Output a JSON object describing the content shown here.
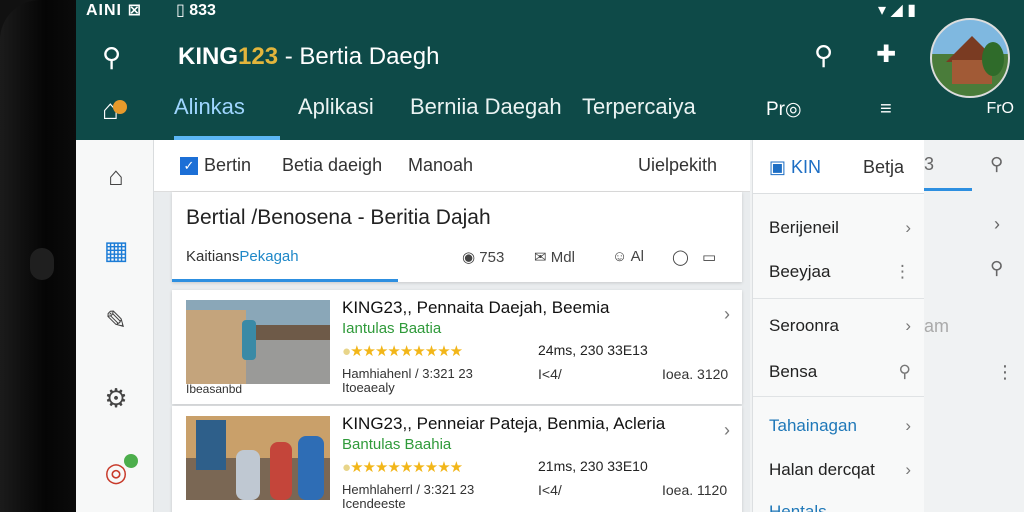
{
  "status": {
    "left": "AINI ⊠",
    "time": "▯ 833",
    "right": "▾ ◢ ▮"
  },
  "appbar": {
    "title_brand": "KING",
    "title_brand_num": "123",
    "title_rest": " - Bertia Daegh",
    "corner_label": "FrO"
  },
  "tabs": [
    "Alinkas",
    "Aplikasi",
    "Berniia Daegah",
    "Terpercaiya"
  ],
  "tab_extras": {
    "pro": "Pr◎",
    "lines": "≡"
  },
  "breadcrumb": {
    "item1": "Bertin",
    "item2": "Betia daeigh",
    "item3": "Manoah",
    "item4": "Uielpekith"
  },
  "heading": {
    "title": "Bertial /Benosena - Beritia Dajah",
    "sub_prefix": "Kaitians",
    "sub_highlight": "Pekagah",
    "meta1": "753",
    "meta2": "Mdl",
    "meta3": "Al"
  },
  "news": [
    {
      "title": "KING23,, Pennaita Daejah, Beemia",
      "subtitle": "Iantulas Baatia",
      "stars": "★★★★★★★★★",
      "date": "24ms, 230 33E13",
      "line1": "Hamhiahenl / 3:321 23",
      "line2": "Itoeaealy",
      "mid": "I<4/",
      "right": "Ioea. 3120",
      "caption": "Ibeasanbd"
    },
    {
      "title": "KING23,, Penneiar Pateja, Benmia, Acleria",
      "subtitle": "Bantulas Baahia",
      "stars": "★★★★★★★★★",
      "date": "21ms, 230 33E10",
      "line1": "Hemhlaherrl / 3:321 23",
      "line2": "Icendeeste",
      "mid": "I<4/",
      "right": "Ioea. 1120",
      "caption": ""
    }
  ],
  "side": {
    "head_kin": "KIN",
    "head_berta": "Betja",
    "items": [
      "Berijeneil",
      "Beeyjaa",
      "Seroonra",
      "Bensa",
      "Tahainagan",
      "Halan dercqat",
      "Hentals"
    ]
  },
  "far": {
    "e1": "am"
  }
}
